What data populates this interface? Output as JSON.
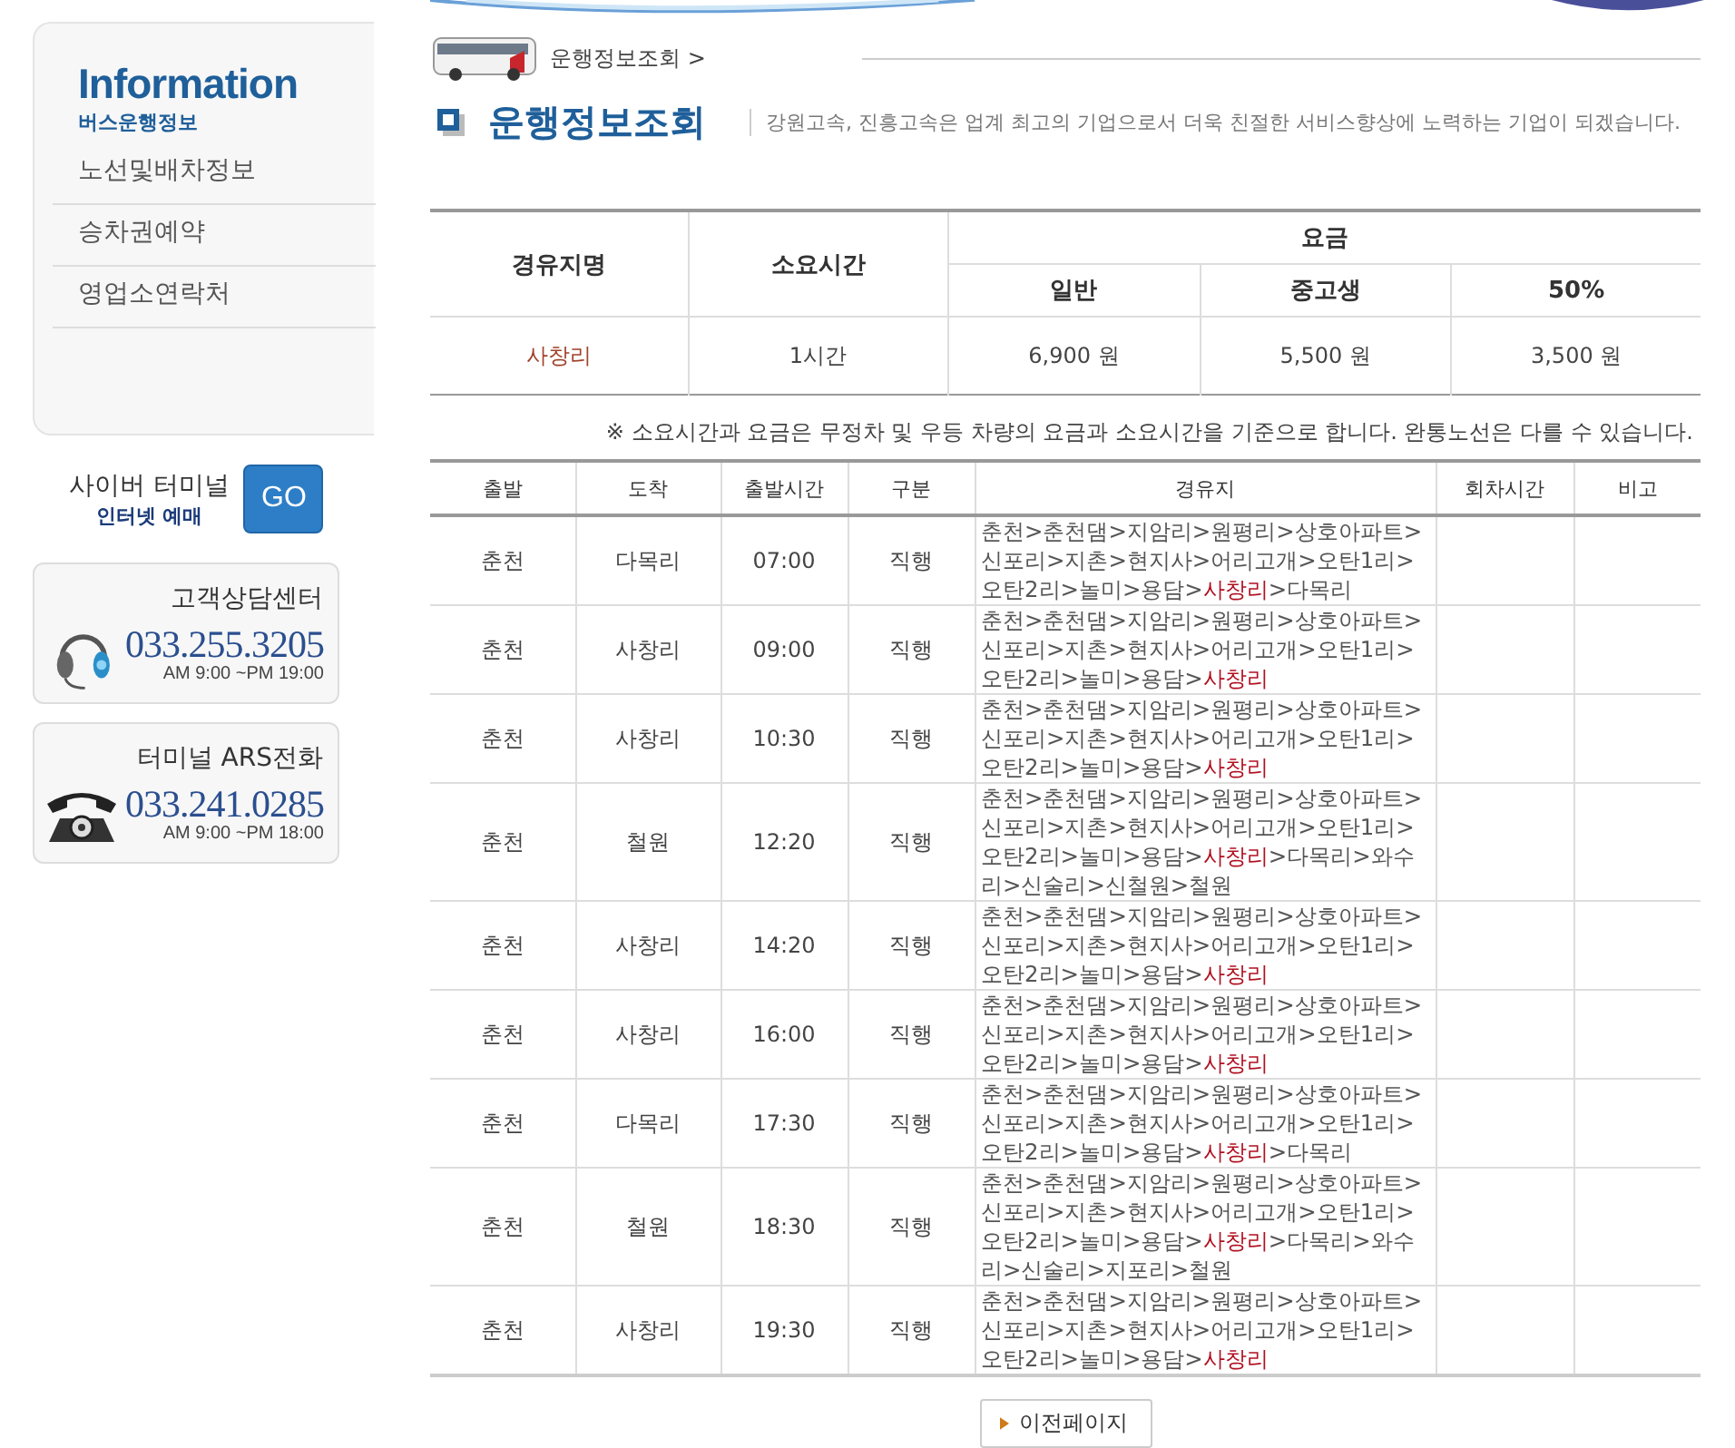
{
  "sidebar": {
    "title": "Information",
    "subtitle": "버스운행정보",
    "menu": [
      {
        "label": "노선및배차정보"
      },
      {
        "label": "승차권예약"
      },
      {
        "label": "영업소연락처"
      }
    ],
    "cyber": {
      "title": "사이버 터미널",
      "subtitle": "인터넷 예매",
      "button": "GO"
    },
    "contacts": [
      {
        "kind": "headset",
        "title": "고객상담센터",
        "phone": "033.255.3205",
        "hours": "AM 9:00 ~PM 19:00"
      },
      {
        "kind": "telephone",
        "title": "터미널 ARS전화",
        "phone": "033.241.0285",
        "hours": "AM 9:00 ~PM 18:00"
      }
    ]
  },
  "breadcrumb": "운행정보조회 >",
  "page_title": "운행정보조회",
  "tagline": "강원고속, 진흥고속은 업계 최고의 기업으로서 더욱 친절한 서비스향상에 노력하는 기업이 되겠습니다.",
  "fare_table": {
    "headers": {
      "stop": "경유지명",
      "duration": "소요시간",
      "fare": "요금",
      "general": "일반",
      "student": "중고생",
      "half": "50%"
    },
    "row": {
      "stop": "사창리",
      "duration": "1시간",
      "general": "6,900 원",
      "student": "5,500 원",
      "half": "3,500 원"
    }
  },
  "note": "※ 소요시간과 요금은 무정차 및 우등 차량의 요금과 소요시간을 기준으로 합니다. 완통노선은 다를 수 있습니다.",
  "schedule": {
    "columns": [
      "출발",
      "도착",
      "출발시간",
      "구분",
      "경유지",
      "회차시간",
      "비고"
    ],
    "rows": [
      {
        "from": "춘천",
        "to": "다목리",
        "time": "07:00",
        "type": "직행",
        "route": "춘천>춘천댐>지암리>원평리>상호아파트>신포리>지촌>현지사>어리고개>오탄1리>오탄2리>놀미>용담>**사창리**>다목리"
      },
      {
        "from": "춘천",
        "to": "사창리",
        "time": "09:00",
        "type": "직행",
        "route": "춘천>춘천댐>지암리>원평리>상호아파트>신포리>지촌>현지사>어리고개>오탄1리>오탄2리>놀미>용담>**사창리**"
      },
      {
        "from": "춘천",
        "to": "사창리",
        "time": "10:30",
        "type": "직행",
        "route": "춘천>춘천댐>지암리>원평리>상호아파트>신포리>지촌>현지사>어리고개>오탄1리>오탄2리>놀미>용담>**사창리**"
      },
      {
        "from": "춘천",
        "to": "철원",
        "time": "12:20",
        "type": "직행",
        "route": "춘천>춘천댐>지암리>원평리>상호아파트>신포리>지촌>현지사>어리고개>오탄1리>오탄2리>놀미>용담>**사창리**>다목리>와수리>신술리>신철원>철원"
      },
      {
        "from": "춘천",
        "to": "사창리",
        "time": "14:20",
        "type": "직행",
        "route": "춘천>춘천댐>지암리>원평리>상호아파트>신포리>지촌>현지사>어리고개>오탄1리>오탄2리>놀미>용담>**사창리**"
      },
      {
        "from": "춘천",
        "to": "사창리",
        "time": "16:00",
        "type": "직행",
        "route": "춘천>춘천댐>지암리>원평리>상호아파트>신포리>지촌>현지사>어리고개>오탄1리>오탄2리>놀미>용담>**사창리**"
      },
      {
        "from": "춘천",
        "to": "다목리",
        "time": "17:30",
        "type": "직행",
        "route": "춘천>춘천댐>지암리>원평리>상호아파트>신포리>지촌>현지사>어리고개>오탄1리>오탄2리>놀미>용담>**사창리**>다목리"
      },
      {
        "from": "춘천",
        "to": "철원",
        "time": "18:30",
        "type": "직행",
        "route": "춘천>춘천댐>지암리>원평리>상호아파트>신포리>지촌>현지사>어리고개>오탄1리>오탄2리>놀미>용담>**사창리**>다목리>와수리>신술리>지포리>철원"
      },
      {
        "from": "춘천",
        "to": "사창리",
        "time": "19:30",
        "type": "직행",
        "route": "춘천>춘천댐>지암리>원평리>상호아파트>신포리>지촌>현지사>어리고개>오탄1리>오탄2리>놀미>용담>**사창리**"
      }
    ]
  },
  "prev_button": "이전페이지"
}
